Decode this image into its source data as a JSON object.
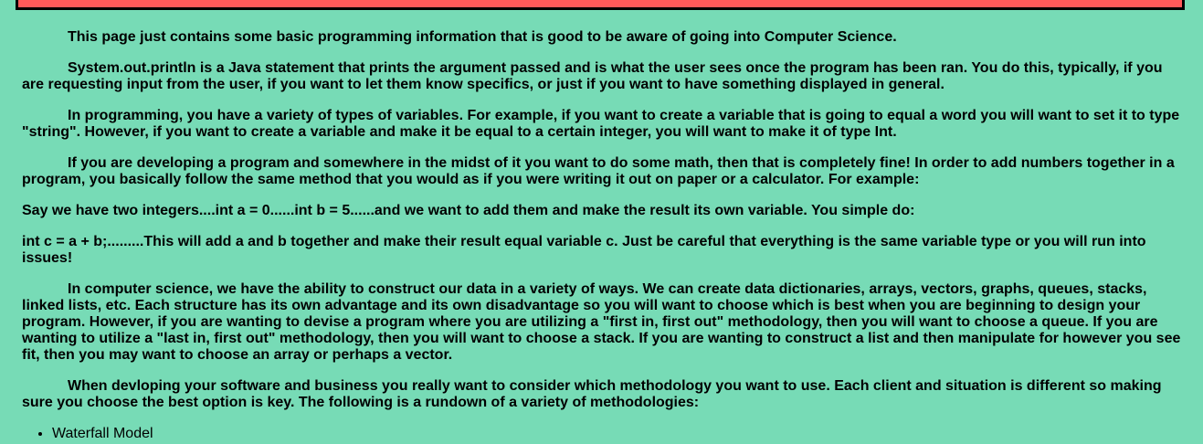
{
  "paragraphs": {
    "intro": "This page just contains some basic programming information that is good to be aware of going into Computer Science.",
    "println": "System.out.println is a Java statement that prints the argument passed and is what the user sees once the program has been ran. You do this, typically, if you are requesting input from the user, if you want to let them know specifics, or just if you want to have something displayed in general.",
    "variables": "In programming, you have a variety of types of variables. For example, if you want to create a variable that is going to equal a word you will want to set it to type \"string\". However, if you want to create a variable and make it be equal to a certain integer, you will want to make it of type Int.",
    "math": "If you are developing a program and somewhere in the midst of it you want to do some math, then that is completely fine! In order to add numbers together in a program, you basically follow the same method that you would as if you were writing it out on paper or a calculator. For example:",
    "example_setup": "Say we have two integers....int a = 0......int b = 5......and we want to add them and make the result its own variable. You simple do:",
    "example_code": "int c = a + b;.........This will add a and b together and make their result equal variable c. Just be careful that everything is the same variable type or you will run into issues!",
    "data_structures": "In computer science, we have the ability to construct our data in a variety of ways. We can create data dictionaries, arrays, vectors, graphs, queues, stacks, linked lists, etc. Each structure has its own advantage and its own disadvantage so you will want to choose which is best when you are beginning to design your program. However, if you are wanting to devise a program where you are utilizing a \"first in, first out\" methodology, then you will want to choose a queue. If you are wanting to utilize a \"last in, first out\" methodology, then you will want to choose a stack. If you are wanting to construct a list and then manipulate for however you see fit, then you may want to choose an array or perhaps a vector.",
    "methodologies": "When devloping your software and business you really want to consider which methodology you want to use. Each client and situation is different so making sure you choose the best option is key. The following is a rundown of a variety of methodologies:"
  },
  "methodology_list": {
    "items": [
      "Waterfall Model"
    ]
  },
  "colors": {
    "background": "#77dbb6",
    "banner": "#ff5a5a"
  }
}
